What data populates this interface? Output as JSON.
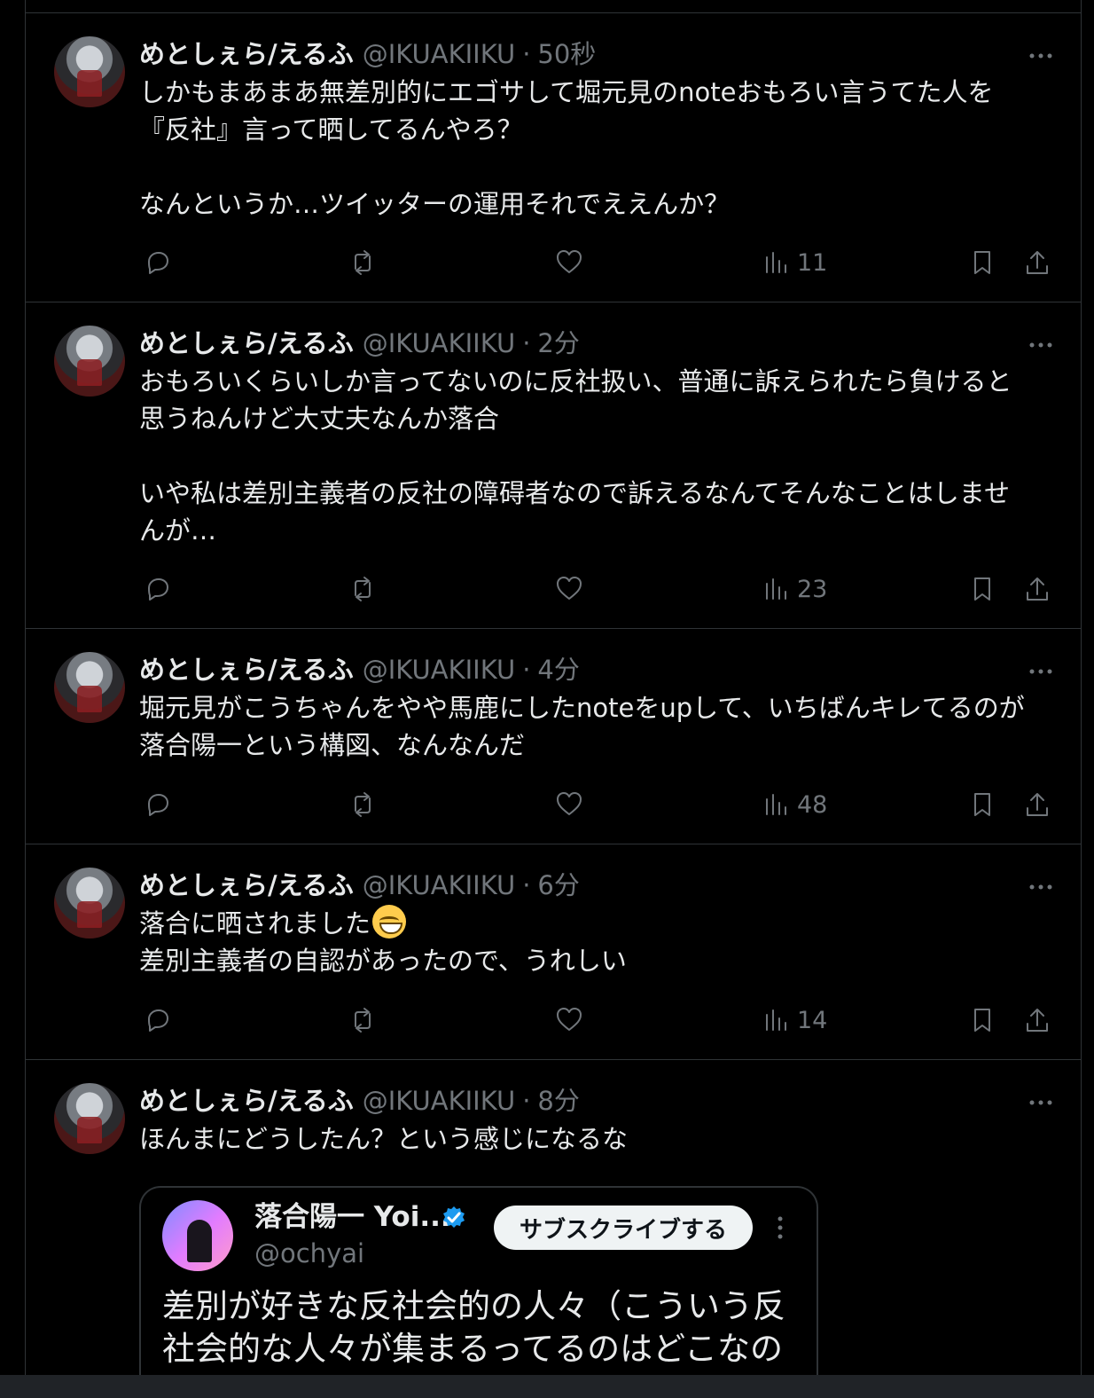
{
  "tweets": [
    {
      "name": "めとしぇら/えるふ",
      "handle": "@IKUAKIIKU",
      "separator": "·",
      "time": "50秒",
      "text": "しかもまあまあ無差別的にエゴサして堀元見のnoteおもろい言うてた人を\n『反社』言って晒してるんやろ？\n\nなんというか…ツイッターの運用それでええんか？",
      "views": "11"
    },
    {
      "name": "めとしぇら/えるふ",
      "handle": "@IKUAKIIKU",
      "separator": "·",
      "time": "2分",
      "text": "おもろいくらいしか言ってないのに反社扱い、普通に訴えられたら負けると\n思うねんけど大丈夫なんか落合\n\nいや私は差別主義者の反社の障碍者なので訴えるなんてそんなことはしませ\nんが…",
      "views": "23"
    },
    {
      "name": "めとしぇら/えるふ",
      "handle": "@IKUAKIIKU",
      "separator": "·",
      "time": "4分",
      "text": "堀元見がこうちゃんをやや馬鹿にしたnoteをupして、いちばんキレてるのが\n落合陽一という構図、なんなんだ",
      "views": "48"
    },
    {
      "name": "めとしぇら/えるふ",
      "handle": "@IKUAKIIKU",
      "separator": "·",
      "time": "6分",
      "text_before_emoji": "落合に晒されました",
      "text_after_emoji": "\n差別主義者の自認があったので、うれしい",
      "views": "14"
    },
    {
      "name": "めとしぇら/えるふ",
      "handle": "@IKUAKIIKU",
      "separator": "·",
      "time": "8分",
      "text": "ほんまにどうしたん？という感じになるな"
    }
  ],
  "quote": {
    "name": "落合陽一 Yoi...",
    "handle": "@ochyai",
    "subscribe_label": "サブスクライブする",
    "text": "差別が好きな反社会的の人々（こういう反\n社会的な人々が集まるってるのはどこなの"
  },
  "icons": [
    "reply-icon",
    "retweet-icon",
    "like-icon",
    "views-icon",
    "bookmark-icon",
    "share-icon",
    "more-icon",
    "verified-icon",
    "grinning-emoji"
  ],
  "colors": {
    "background": "#000000",
    "text": "#e7e9ea",
    "muted": "#71767b",
    "border": "#2f3336",
    "verified": "#1d9bf0",
    "button": "#eff3f4"
  }
}
